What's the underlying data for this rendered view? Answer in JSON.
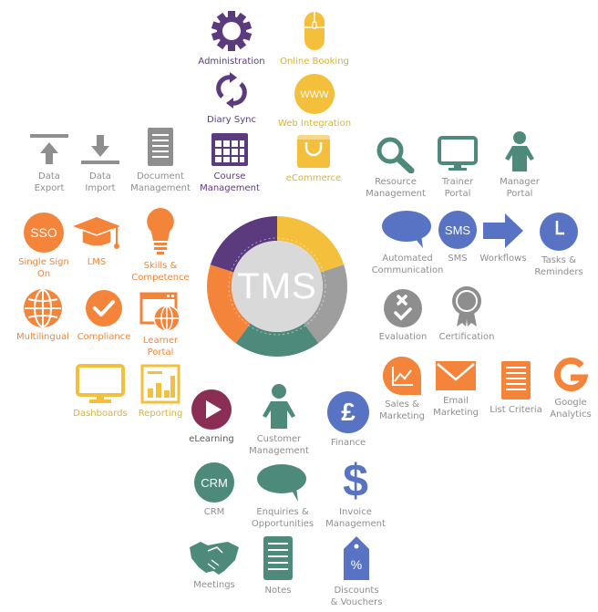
{
  "hub": {
    "label": "TMS",
    "segments": [
      "#f4bf3a",
      "#9e9e9e",
      "#4e8a7c",
      "#f4843a",
      "#5c3a7e"
    ],
    "center_color": "#d9d9d9"
  },
  "colors": {
    "purple": "#5c3a7e",
    "yellow": "#f4bf3a",
    "gray": "#8e8e8e",
    "teal": "#4e8a7c",
    "orange": "#f4843a",
    "blue": "#5873c4",
    "maroon": "#8a2e55"
  },
  "items": {
    "administration": "Administration",
    "online_booking": "Online Booking",
    "diary_sync": "Diary Sync",
    "web_integration": "Web Integration",
    "www_text": "WWW",
    "data_export": "Data\nExport",
    "data_import": "Data\nImport",
    "document_management": "Document\nManagement",
    "course_management": "Course\nManagement",
    "ecommerce": "eCommerce",
    "resource_management": "Resource\nManagement",
    "trainer_portal": "Trainer\nPortal",
    "manager_portal": "Manager\nPortal",
    "single_sign_on": "Single Sign\nOn",
    "sso_text": "SSO",
    "lms": "LMS",
    "skills_competence": "Skills &\nCompetence",
    "multilingual": "Multilingual",
    "compliance": "Compliance",
    "learner_portal": "Learner\nPortal",
    "automated_communication": "Automated\nCommunication",
    "sms": "SMS",
    "sms_text": "SMS",
    "workflows": "Workflows",
    "tasks_reminders": "Tasks &\nReminders",
    "evaluation": "Evaluation",
    "certification": "Certification",
    "sales_marketing": "Sales &\nMarketing",
    "email_marketing": "Email\nMarketing",
    "list_criteria": "List Criteria",
    "google_analytics": "Google\nAnalytics",
    "dashboards": "Dashboards",
    "reporting": "Reporting",
    "elearning": "eLearning",
    "customer_management": "Customer\nManagement",
    "finance": "Finance",
    "crm": "CRM",
    "crm_text": "CRM",
    "enquiries_opportunities": "Enquiries &\nOpportunities",
    "invoice_management": "Invoice\nManagement",
    "meetings": "Meetings",
    "notes": "Notes",
    "discounts_vouchers": "Discounts\n& Vouchers",
    "discount_text": "%"
  }
}
